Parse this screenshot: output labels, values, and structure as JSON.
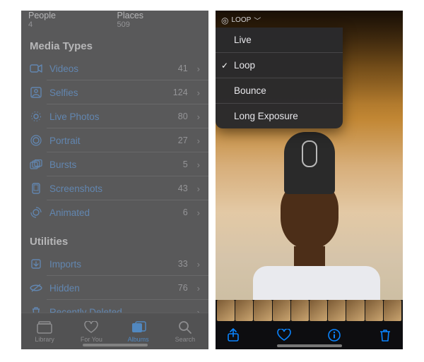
{
  "left": {
    "album_tiles": [
      {
        "title": "People",
        "subtitle": "4"
      },
      {
        "title": "Places",
        "subtitle": "509"
      }
    ],
    "section_media_types": "Media Types",
    "media_types": [
      {
        "icon": "video-icon",
        "label": "Videos",
        "count": "41"
      },
      {
        "icon": "selfie-icon",
        "label": "Selfies",
        "count": "124"
      },
      {
        "icon": "livephoto-icon",
        "label": "Live Photos",
        "count": "80"
      },
      {
        "icon": "portrait-icon",
        "label": "Portrait",
        "count": "27"
      },
      {
        "icon": "bursts-icon",
        "label": "Bursts",
        "count": "5"
      },
      {
        "icon": "screenshots-icon",
        "label": "Screenshots",
        "count": "43"
      },
      {
        "icon": "animated-icon",
        "label": "Animated",
        "count": "6"
      }
    ],
    "section_utilities": "Utilities",
    "utilities": [
      {
        "icon": "imports-icon",
        "label": "Imports",
        "count": "33"
      },
      {
        "icon": "hidden-icon",
        "label": "Hidden",
        "count": "76"
      },
      {
        "icon": "recently-icon",
        "label": "Recently Deleted",
        "count": ""
      }
    ],
    "tabs": [
      {
        "icon": "library-tab-icon",
        "label": "Library",
        "active": false
      },
      {
        "icon": "foryou-tab-icon",
        "label": "For You",
        "active": false
      },
      {
        "icon": "albums-tab-icon",
        "label": "Albums",
        "active": true
      },
      {
        "icon": "search-tab-icon",
        "label": "Search",
        "active": false
      }
    ]
  },
  "right": {
    "pill_label": "LOOP",
    "menu": [
      {
        "label": "Live",
        "selected": false
      },
      {
        "label": "Loop",
        "selected": true
      },
      {
        "label": "Bounce",
        "selected": false
      },
      {
        "label": "Long Exposure",
        "selected": false
      }
    ],
    "bottom_icons": [
      "share-icon",
      "heart-icon",
      "info-icon",
      "trash-icon"
    ]
  }
}
